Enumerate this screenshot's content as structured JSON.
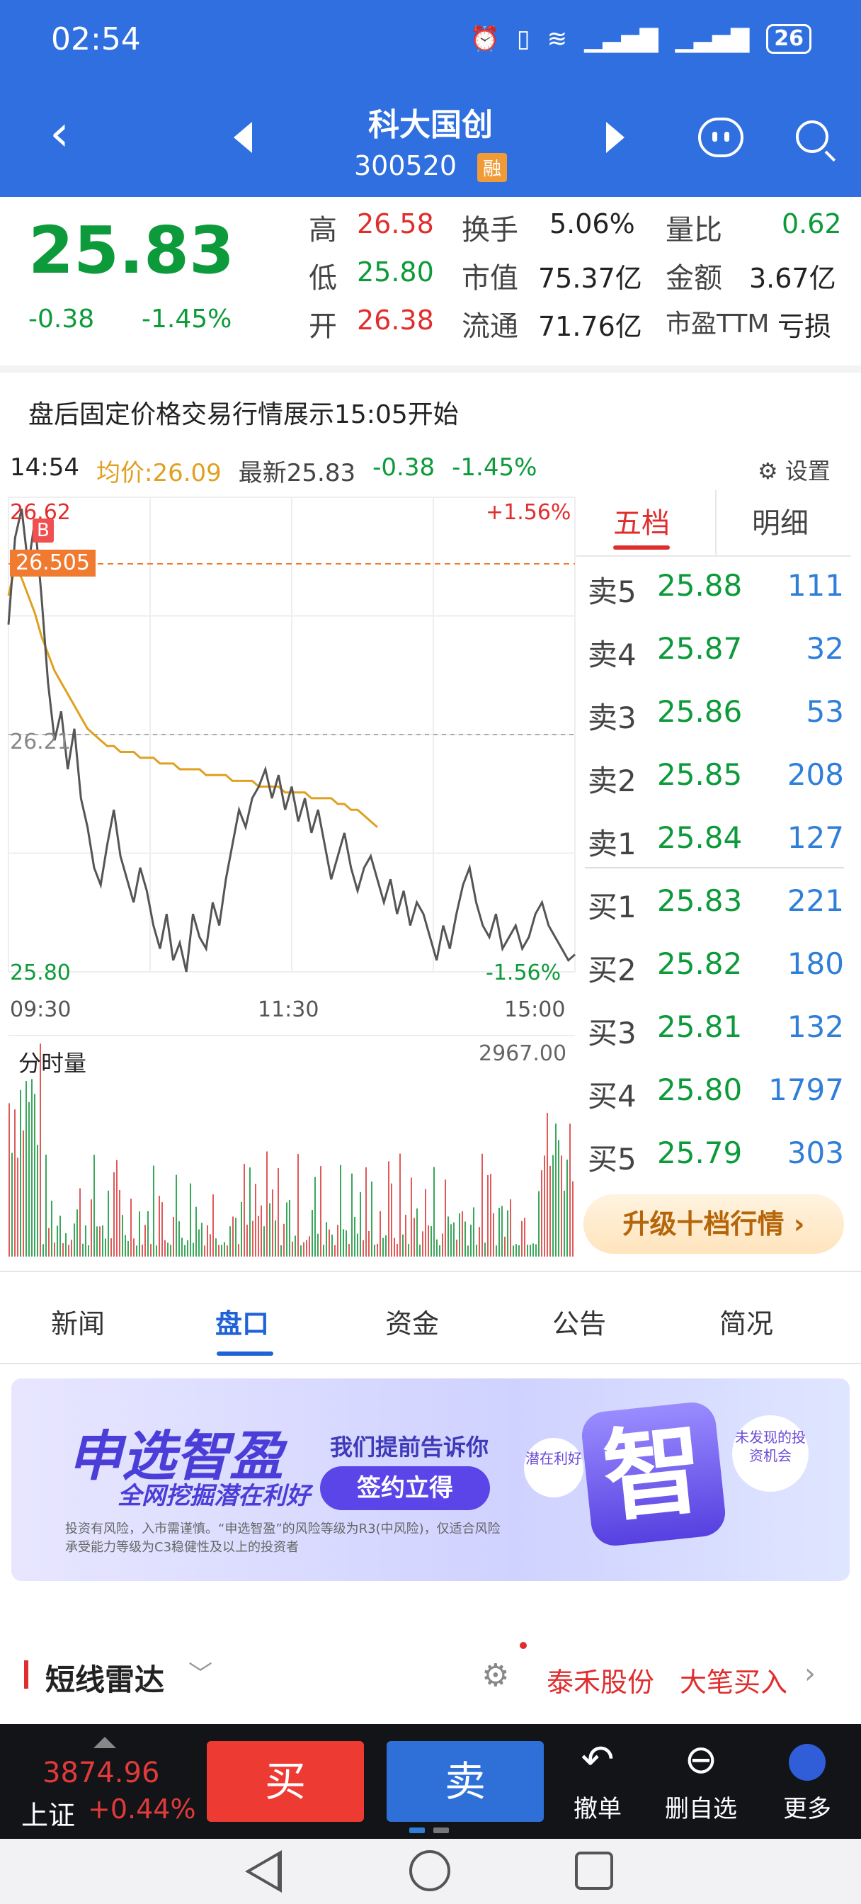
{
  "status": {
    "time": "02:54",
    "battery": "26"
  },
  "header": {
    "name": "科大国创",
    "code": "300520",
    "badge": "融"
  },
  "quote": {
    "price": "25.83",
    "change": "-0.38",
    "change_pct": "-1.45%",
    "stats": [
      {
        "label": "高",
        "value": "26.58",
        "color": "red"
      },
      {
        "label": "换手",
        "value": "5.06%",
        "color": "dark"
      },
      {
        "label": "量比",
        "value": "0.62",
        "color": "green"
      },
      {
        "label": "低",
        "value": "25.80",
        "color": "green"
      },
      {
        "label": "市值",
        "value": "75.37亿",
        "color": "dark"
      },
      {
        "label": "金额",
        "value": "3.67亿",
        "color": "dark"
      },
      {
        "label": "开",
        "value": "26.38",
        "color": "red"
      },
      {
        "label": "流通",
        "value": "71.76亿",
        "color": "dark"
      },
      {
        "label": "市盈TTM",
        "value": "亏损",
        "color": "dark"
      }
    ]
  },
  "notice": "盘后固定价格交易行情展示15:05开始",
  "info": {
    "time": "14:54",
    "avg": "均价:26.09",
    "latest": "最新25.83",
    "chg": "-0.38",
    "pct": "-1.45%",
    "settings": "设置"
  },
  "chart_data": {
    "type": "line",
    "y_high_label": "26.62",
    "y_mid_label": "26.21",
    "y_low_label": "25.80",
    "pct_high": "+1.56%",
    "pct_low": "-1.56%",
    "x_labels": [
      "09:30",
      "11:30",
      "15:00"
    ],
    "ylim": [
      25.8,
      26.62
    ],
    "buy_marker": {
      "label": "B",
      "price_label": "26.505"
    },
    "series": [
      {
        "name": "最新",
        "color": "#555555",
        "values": [
          26.4,
          26.55,
          26.6,
          26.5,
          26.58,
          26.45,
          26.3,
          26.2,
          26.25,
          26.15,
          26.22,
          26.1,
          26.05,
          25.98,
          25.95,
          26.02,
          26.08,
          26.0,
          25.96,
          25.92,
          25.98,
          25.94,
          25.88,
          25.84,
          25.9,
          25.82,
          25.85,
          25.8,
          25.9,
          25.86,
          25.84,
          25.92,
          25.88,
          25.96,
          26.02,
          26.08,
          26.05,
          26.1,
          26.12,
          26.15,
          26.1,
          26.14,
          26.08,
          26.12,
          26.06,
          26.1,
          26.04,
          26.08,
          26.02,
          25.96,
          26.0,
          26.04,
          25.98,
          25.94,
          25.98,
          26.0,
          25.96,
          25.92,
          25.96,
          25.9,
          25.94,
          25.88,
          25.92,
          25.9,
          25.86,
          25.82,
          25.88,
          25.84,
          25.9,
          25.95,
          25.98,
          25.92,
          25.88,
          25.86,
          25.9,
          25.84,
          25.86,
          25.88,
          25.84,
          25.86,
          25.9,
          25.92,
          25.88,
          25.86,
          25.84,
          25.82,
          25.83
        ]
      },
      {
        "name": "均价",
        "color": "#e0a020",
        "values": [
          26.45,
          26.5,
          26.48,
          26.45,
          26.42,
          26.38,
          26.35,
          26.32,
          26.3,
          26.28,
          26.26,
          26.24,
          26.22,
          26.21,
          26.2,
          26.19,
          26.19,
          26.18,
          26.18,
          26.18,
          26.17,
          26.17,
          26.17,
          26.16,
          26.16,
          26.16,
          26.15,
          26.15,
          26.15,
          26.15,
          26.14,
          26.14,
          26.14,
          26.14,
          26.13,
          26.13,
          26.13,
          26.13,
          26.12,
          26.12,
          26.12,
          26.12,
          26.11,
          26.11,
          26.11,
          26.11,
          26.1,
          26.1,
          26.1,
          26.1,
          26.09,
          26.09,
          26.08,
          26.08,
          26.07,
          26.06,
          26.05
        ]
      }
    ],
    "volume": {
      "title": "分时量",
      "max_label": "2967.00"
    }
  },
  "book": {
    "tabs": [
      "五档",
      "明细"
    ],
    "rows": [
      {
        "label": "卖5",
        "price": "25.88",
        "qty": "111"
      },
      {
        "label": "卖4",
        "price": "25.87",
        "qty": "32"
      },
      {
        "label": "卖3",
        "price": "25.86",
        "qty": "53"
      },
      {
        "label": "卖2",
        "price": "25.85",
        "qty": "208"
      },
      {
        "label": "卖1",
        "price": "25.84",
        "qty": "127"
      },
      {
        "label": "买1",
        "price": "25.83",
        "qty": "221"
      },
      {
        "label": "买2",
        "price": "25.82",
        "qty": "180"
      },
      {
        "label": "买3",
        "price": "25.81",
        "qty": "132"
      },
      {
        "label": "买4",
        "price": "25.80",
        "qty": "1797"
      },
      {
        "label": "买5",
        "price": "25.79",
        "qty": "303"
      }
    ],
    "upgrade": "升级十档行情 ›"
  },
  "tabs": [
    "新闻",
    "盘口",
    "资金",
    "公告",
    "简况"
  ],
  "banner": {
    "title": "申选智盈",
    "subtitle": "全网挖掘潜在利好",
    "tell": "我们提前告诉你",
    "button": "签约立得",
    "risk": "投资有风险，入市需谨慎。“申选智盈”的风险等级为R3(中风险)，仅适合风险承受能力等级为C3稳健性及以上的投资者",
    "hint1": "潜在利好",
    "hint2": "未发现的投资机会",
    "zhi": "智"
  },
  "radar": {
    "title": "短线雷达",
    "stock": "泰禾股份",
    "action": "大笔买入"
  },
  "bottom": {
    "index_value": "3874.96",
    "index_name": "上证",
    "index_pct": "+0.44%",
    "buy": "买",
    "sell": "卖",
    "cancel": "撤单",
    "remove": "删自选",
    "more": "更多"
  }
}
